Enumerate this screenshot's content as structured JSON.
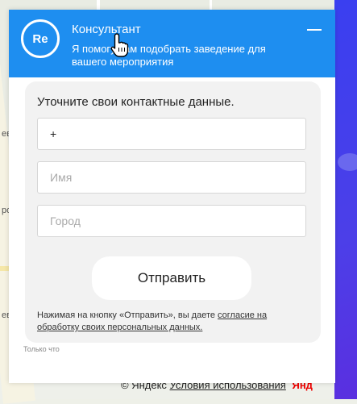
{
  "widget": {
    "avatar_text": "Re",
    "title": "Консультант",
    "subtitle": "Я помогу вам подобрать заведение для вашего мероприятия",
    "minimize_icon": "minimize-icon"
  },
  "form": {
    "prompt": "Уточните свои контактные данные.",
    "phone_value": "+",
    "name_placeholder": "Имя",
    "city_placeholder": "Город",
    "submit_label": "Отправить",
    "consent_text": "Нажимая на кнопку «Отправить», вы даете ",
    "consent_link": "согласие на обработку своих персональных данных.",
    "timestamp": "Только что"
  },
  "map": {
    "copyright": "© Яндекс",
    "terms_link": "Условия использования",
    "logo": "Янд",
    "side_labels": [
      "ев",
      "рог",
      "ев"
    ]
  },
  "colors": {
    "header": "#1e8ef0",
    "accent_strip": "#4c3fe8"
  }
}
